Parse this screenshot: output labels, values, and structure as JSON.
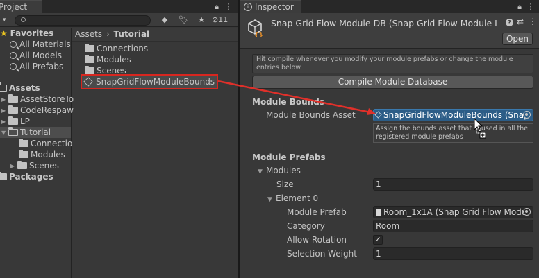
{
  "project_panel": {
    "tab_label": "Project",
    "search_placeholder": "",
    "hidden_count": "11",
    "favorites": {
      "label": "Favorites",
      "items": [
        "All Materials",
        "All Models",
        "All Prefabs"
      ]
    },
    "assets": {
      "label": "Assets",
      "items": [
        "AssetStoreTo",
        "CodeRespaw",
        "LP",
        "Tutorial"
      ],
      "tutorial_children": [
        "Connectio",
        "Modules",
        "Scenes"
      ]
    },
    "packages_label": "Packages",
    "breadcrumb": {
      "root": "Assets",
      "separator": "›",
      "current": "Tutorial"
    },
    "files": [
      "Connections",
      "Modules",
      "Scenes"
    ],
    "selected_asset": "SnapGridFlowModuleBounds"
  },
  "inspector": {
    "tab_label": "Inspector",
    "title": "Snap Grid Flow Module DB (Snap Grid Flow Module I",
    "open_button": "Open",
    "help_text": "Hit compile whenever you modify your module prefabs or change the module entries below",
    "compile_button": "Compile Module Database",
    "bounds_section": {
      "header": "Module Bounds",
      "asset_label": "Module Bounds Asset",
      "asset_value": "SnapGridFlowModuleBounds (Snap",
      "tooltip": "Assign the bounds asset that is used in all the registered module prefabs"
    },
    "prefabs_section": {
      "header": "Module Prefabs",
      "modules_label": "Modules",
      "size_label": "Size",
      "size_value": "1",
      "element_label": "Element 0",
      "module_prefab_label": "Module Prefab",
      "module_prefab_value": "Room_1x1A (Snap Grid Flow Modul",
      "category_label": "Category",
      "category_value": "Room",
      "allow_rotation_label": "Allow Rotation",
      "allow_rotation_checked": true,
      "selection_weight_label": "Selection Weight",
      "selection_weight_value": "1"
    }
  },
  "colors": {
    "panel_bg": "#383838",
    "field_bg": "#2a2a2a",
    "selection_blue": "#2c5d87",
    "highlight_red": "#e0302a"
  }
}
